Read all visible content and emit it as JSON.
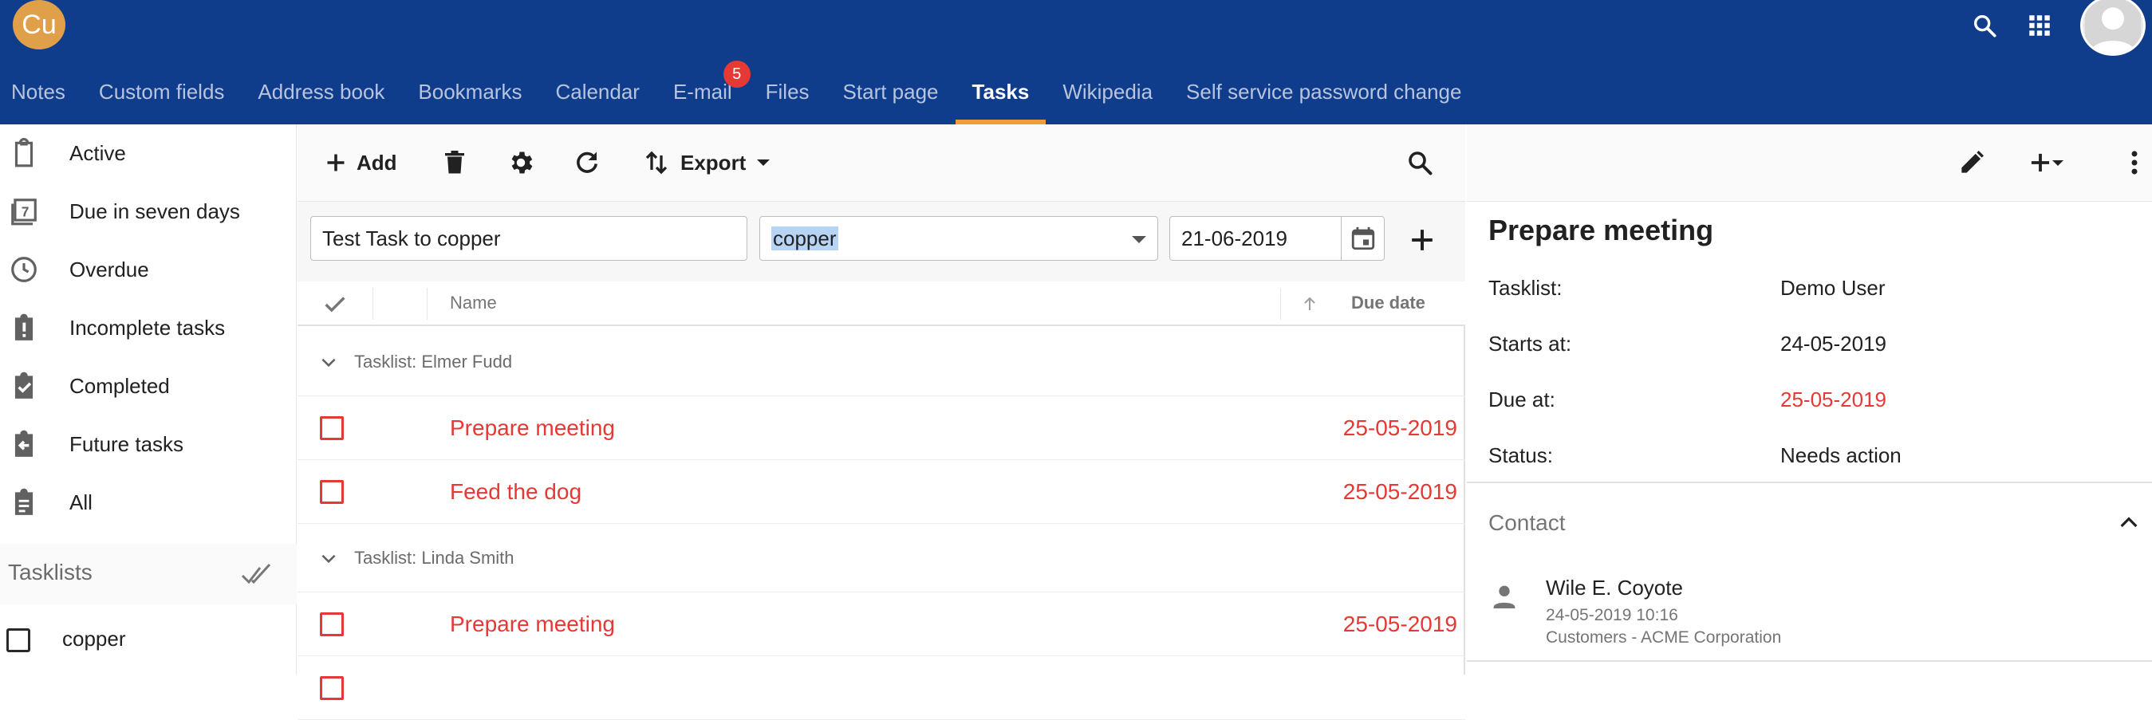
{
  "header": {
    "logo_text": "Cu",
    "icons": [
      "search-icon",
      "apps-grid-icon",
      "user-avatar"
    ]
  },
  "nav": {
    "tabs": [
      {
        "label": "Notes"
      },
      {
        "label": "Custom fields"
      },
      {
        "label": "Address book"
      },
      {
        "label": "Bookmarks"
      },
      {
        "label": "Calendar"
      },
      {
        "label": "E-mail",
        "badge": "5"
      },
      {
        "label": "Files"
      },
      {
        "label": "Start page"
      },
      {
        "label": "Tasks",
        "active": true
      },
      {
        "label": "Wikipedia"
      },
      {
        "label": "Self service password change"
      }
    ]
  },
  "sidebar": {
    "filters": [
      {
        "label": "Active",
        "icon": "clipboard-icon"
      },
      {
        "label": "Due in seven days",
        "icon": "seven-days-icon"
      },
      {
        "label": "Overdue",
        "icon": "clock-icon"
      },
      {
        "label": "Incomplete tasks",
        "icon": "clipboard-alert-icon"
      },
      {
        "label": "Completed",
        "icon": "clipboard-check-icon"
      },
      {
        "label": "Future tasks",
        "icon": "clipboard-arrow-left-icon"
      },
      {
        "label": "All",
        "icon": "clipboard-text-icon"
      }
    ],
    "tasklists_heading": "Tasklists",
    "tasklists": [
      {
        "label": "copper",
        "checked": false
      }
    ]
  },
  "toolbar": {
    "add_label": "Add",
    "export_label": "Export"
  },
  "quick_add": {
    "task_name": "Test Task to copper",
    "tasklist": "copper",
    "due_date": "21-06-2019"
  },
  "table": {
    "col_name": "Name",
    "col_due": "Due date"
  },
  "groups": [
    {
      "label": "Tasklist: Elmer Fudd",
      "tasks": [
        {
          "name": "Prepare meeting",
          "due": "25-05-2019"
        },
        {
          "name": "Feed the dog",
          "due": "25-05-2019"
        }
      ]
    },
    {
      "label": "Tasklist: Linda Smith",
      "tasks": [
        {
          "name": "Prepare meeting",
          "due": "25-05-2019"
        }
      ]
    }
  ],
  "detail": {
    "title": "Prepare meeting",
    "props": [
      {
        "label": "Tasklist:",
        "value": "Demo User",
        "overdue": false
      },
      {
        "label": "Starts at:",
        "value": "24-05-2019",
        "overdue": false
      },
      {
        "label": "Due at:",
        "value": "25-05-2019",
        "overdue": true
      },
      {
        "label": "Status:",
        "value": "Needs action",
        "overdue": false
      }
    ],
    "contact_heading": "Contact",
    "contact": {
      "name": "Wile E. Coyote",
      "datetime": "24-05-2019 10:16",
      "organization": "Customers - ACME Corporation"
    }
  },
  "colors": {
    "header_bg": "#0f3d8c",
    "active_tab_underline": "#f29c38",
    "overdue_red": "#e53935",
    "badge_red": "#e53935",
    "logo_orange": "#e0a04a"
  }
}
